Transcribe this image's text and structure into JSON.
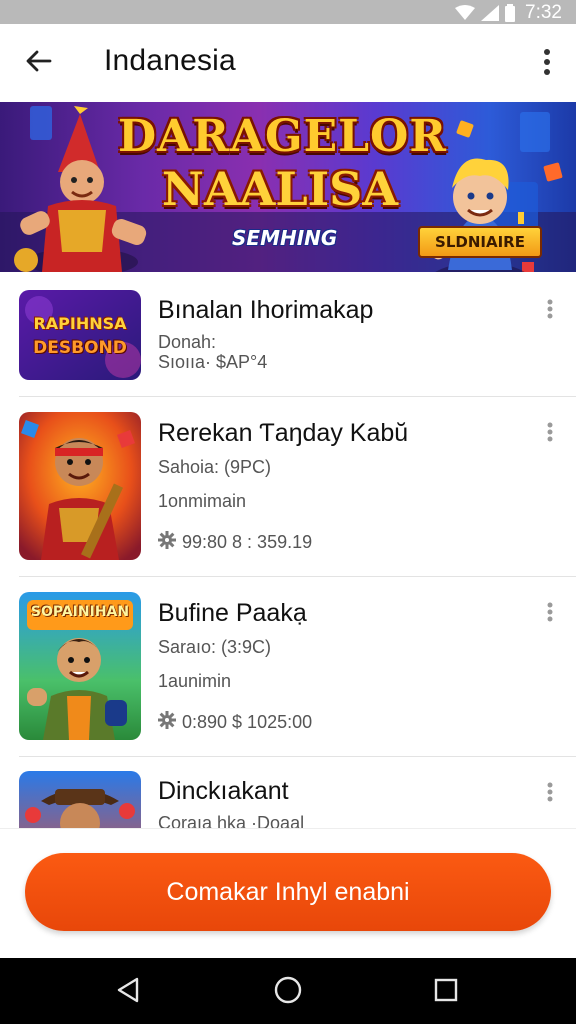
{
  "status_bar": {
    "time": "7:32"
  },
  "app_bar": {
    "title": "Indanesia"
  },
  "banner": {
    "title_line1": "DARAGELOR",
    "title_line2": "NAALISA",
    "subtitle": "SEMHING",
    "badge": "SLDNIAIRE"
  },
  "items": [
    {
      "title": "Bınalan Ihorimakap",
      "line1": "Donah:",
      "line2": "Sıoııa· $AP°4",
      "thumb_text_top": "RAPIHNSA",
      "thumb_text_bottom": "DESBOND"
    },
    {
      "title": "Rerekan Ƭaŋday Kabŭ",
      "line1": "Sahoia: (9PC)",
      "line2": "1onmimain",
      "rating": "99:80 8 : 359.19"
    },
    {
      "title": "Bufine Paakạ",
      "line1": "Saraıo: (3:9C)",
      "line2": "1aunimin",
      "rating": "0:890 $ 1025:00",
      "thumb_text_top": "SOPAINIHAN"
    },
    {
      "title": "Dinckıakant",
      "line1": "Coraıa hka ·Doaal"
    }
  ],
  "cta": {
    "label": "Comakar Inhyl enabni"
  },
  "colors": {
    "accent": "#f0520c",
    "status_bar": "#b9b9b9",
    "nav_bar": "#000000"
  }
}
